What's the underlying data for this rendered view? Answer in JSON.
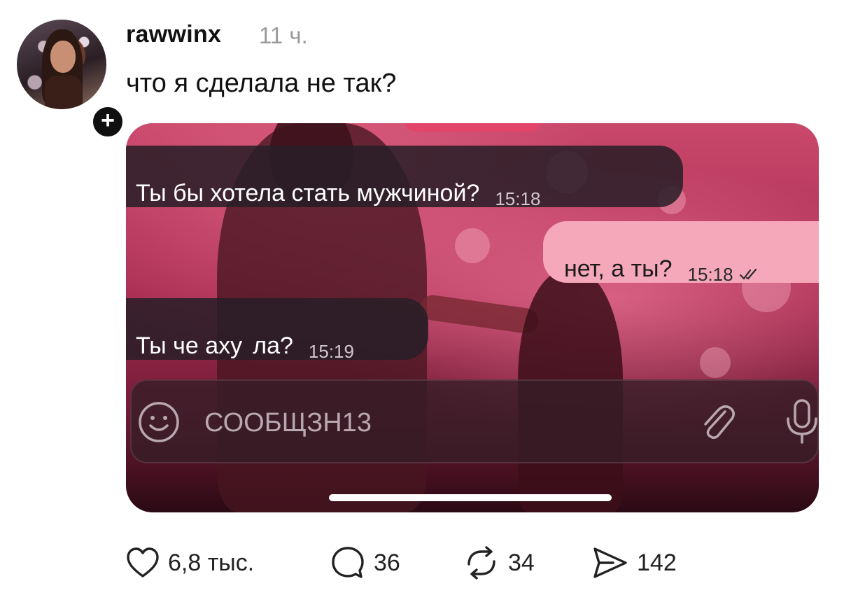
{
  "post": {
    "username": "rawwinx",
    "time_ago": "11 ч.",
    "caption": "что я сделала не так?",
    "follow_symbol": "+"
  },
  "chat": {
    "messages": [
      {
        "direction": "incoming",
        "text": "Ты бы хотела стать мужчиной?",
        "time": "15:18"
      },
      {
        "direction": "outgoing",
        "text": "нет, а ты?",
        "time": "15:18",
        "status": "read"
      },
      {
        "direction": "incoming",
        "text": "Ты че аху  ла?",
        "time": "15:19"
      }
    ],
    "input_placeholder": "СООБЩЗН13",
    "colors": {
      "outgoing_bubble": "#f6a8bb",
      "incoming_bubble": "#281e26",
      "background": "#a82c52"
    }
  },
  "actions": {
    "likes": "6,8 тыс.",
    "comments": "36",
    "reposts": "34",
    "shares": "142"
  },
  "icons": [
    "follow-plus-icon",
    "smile-icon",
    "paperclip-icon",
    "microphone-icon",
    "double-check-icon",
    "heart-icon",
    "comment-icon",
    "repost-icon",
    "share-icon"
  ]
}
